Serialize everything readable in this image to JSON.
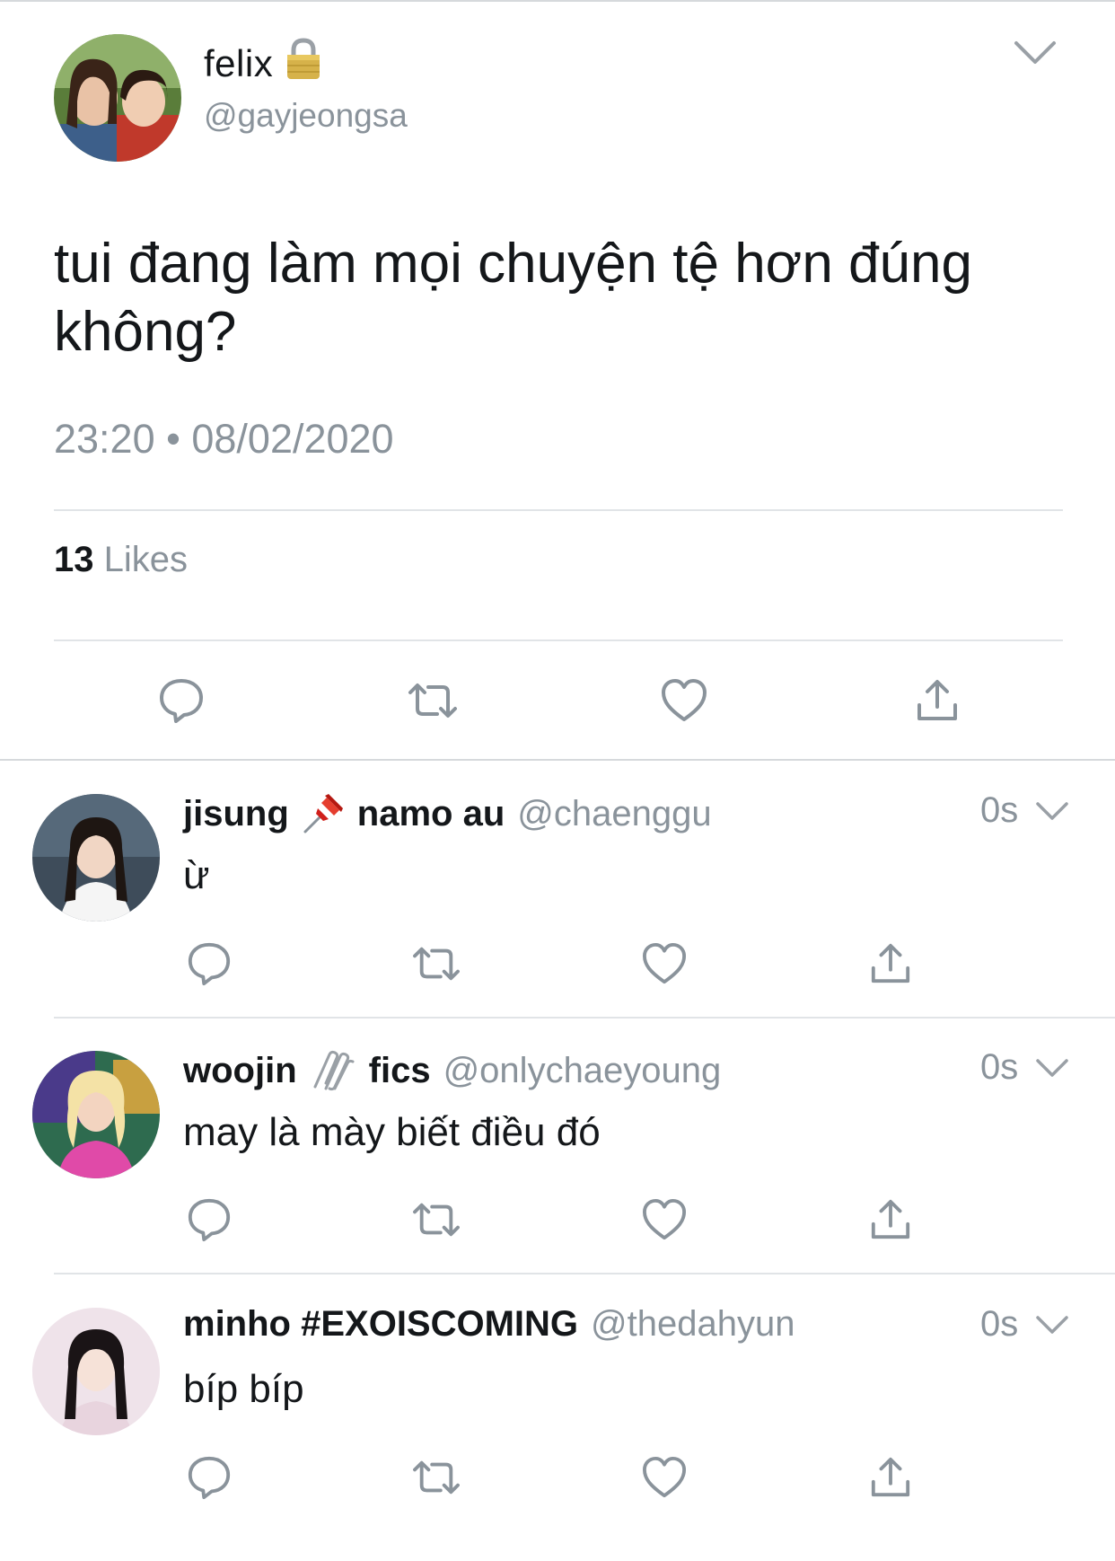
{
  "tweet": {
    "name": "felix",
    "lock_icon": "lock-icon",
    "handle": "@gayjeongsa",
    "text_line1": "tui đang làm mọi chuyện tệ hơn đúng",
    "text_line2": "không?",
    "timestamp": "23:20 • 08/02/2020",
    "likes_count": "13",
    "likes_label": "Likes"
  },
  "replies": [
    {
      "name": "jisung",
      "emoji_icon": "pushpin-icon",
      "name_suffix": "namo au",
      "handle": "@chaenggu",
      "time": "0s",
      "text": "ừ"
    },
    {
      "name": "woojin",
      "emoji_icon": "paperclips-icon",
      "name_suffix": "fics",
      "handle": "@onlychaeyoung",
      "time": "0s",
      "text": "may là mày biết điều đó"
    },
    {
      "name": "minho #EXOISCOMING",
      "emoji_icon": "",
      "name_suffix": "",
      "handle": "@thedahyun",
      "time": "0s",
      "text": "bíp bíp"
    }
  ],
  "colors": {
    "text": "#14171a",
    "secondary": "#8a939b",
    "icon": "#8a939b",
    "divider": "#e1e4e7"
  }
}
